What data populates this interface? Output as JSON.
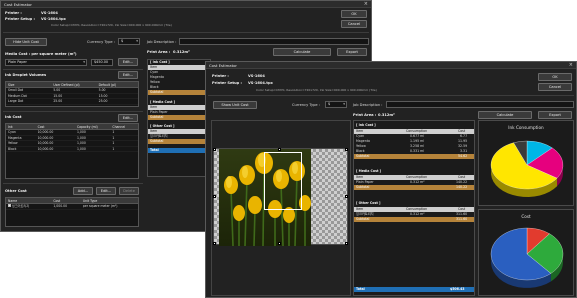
{
  "back": {
    "title": "Cost Estimator",
    "close_glyph": "×",
    "printer_label": "Printer :",
    "printer_value": "VS-1604",
    "setup_label": "Printer Setup :",
    "setup_value": "VS-1604.tpx",
    "setup_detail": "Color Setup=CMYK, Resolution=720x720, Ink Size=900.000 x 900.000mm (Tile)",
    "ok_label": "OK",
    "cancel_label": "Cancel",
    "hide_unit_cost": "Hide Unit Cost",
    "currency_label": "Currency Type :",
    "currency_value": "$",
    "job_desc_label": "Job Description :",
    "print_area_label": "Print Area :",
    "print_area_value": "0.312m²",
    "calculate": "Calculate",
    "export": "Export",
    "media_cost_label": "Media Cost : per square meter (m²)",
    "media_value": "Plain Paper",
    "media_price": "$450.00",
    "edit": "Edit...",
    "droplet_title": "Ink Droplet Volumes",
    "droplet_cols": [
      "Size",
      "User Defined (pl)",
      "Default (pl)"
    ],
    "droplet_rows": [
      [
        "Small Dot",
        "5.00",
        "5.00"
      ],
      [
        "Medium Dot",
        "15.00",
        "15.00"
      ],
      [
        "Large Dot",
        "25.00",
        "25.00"
      ]
    ],
    "ink_cost_title": "Ink Cost",
    "ink_cols": [
      "Ink",
      "Cost",
      "Capacity (ml)",
      "Channel"
    ],
    "ink_rows": [
      [
        "Cyan",
        "10,000.00",
        "1,000",
        "1"
      ],
      [
        "Magenta",
        "10,000.00",
        "1,000",
        "1"
      ],
      [
        "Yellow",
        "10,000.00",
        "1,000",
        "1"
      ],
      [
        "Black",
        "10,000.00",
        "1,000",
        "1"
      ]
    ],
    "other_cost_title": "Other Cost",
    "add": "Add...",
    "edit2": "Edit...",
    "delete": "Delete",
    "other_cols": [
      "Name",
      "Cost",
      "Unit Type"
    ],
    "other_rows": [
      [
        "잉크카트리지",
        "1,000.00",
        "per square meter (m²)"
      ]
    ],
    "summary": {
      "ink_cost": "[ Ink Cost ]",
      "ink_items": [
        "Item",
        "Cyan",
        "Magenta",
        "Yellow",
        "Black",
        "Subtotal"
      ],
      "media_cost": "[ Media Cost ]",
      "media_items": [
        "Item",
        "Plain Paper",
        "Subtotal"
      ],
      "other_cost": "[ Other Cost ]",
      "other_items": [
        "Item",
        "잉크카트리지",
        "Subtotal"
      ],
      "total": "Total"
    }
  },
  "front": {
    "title": "Cost Estimator",
    "close_glyph": "×",
    "printer_label": "Printer :",
    "printer_value": "VS-1604",
    "setup_label": "Printer Setup :",
    "setup_value": "VS-1604.tpx",
    "setup_detail": "Color Setup=CMYK, Resolution=720x720, Ink Size=900.000 x 900.000mm (Tile)",
    "ok_label": "OK",
    "cancel_label": "Cancel",
    "show_unit_cost": "Show Unit Cost",
    "currency_label": "Currency Type :",
    "currency_value": "$",
    "job_desc_label": "Job Description :",
    "print_area_label": "Print Area :",
    "print_area_value": "0.312m²",
    "calculate": "Calculate",
    "export": "Export",
    "ink_cost": {
      "title": "[ Ink Cost ]",
      "cols": [
        "Item",
        "Consumption",
        "Cost"
      ],
      "rows": [
        [
          "Cyan",
          "0.677 ml",
          "6.77"
        ],
        [
          "Magenta",
          "1.195 ml",
          "11.95"
        ],
        [
          "Yellow",
          "3.258 ml",
          "32.59"
        ],
        [
          "Black",
          "0.331 ml",
          "3.31"
        ]
      ],
      "subtotal": [
        "Subtotal",
        "",
        "54.62"
      ]
    },
    "media_cost": {
      "title": "[ Media Cost ]",
      "cols": [
        "Item",
        "Consumption",
        "Cost"
      ],
      "rows": [
        [
          "Plain Paper",
          "0.312 m²",
          "140.22"
        ]
      ],
      "subtotal": [
        "Subtotal",
        "",
        "140.22"
      ]
    },
    "other_cost": {
      "title": "[ Other Cost ]",
      "cols": [
        "Item",
        "Consumption",
        "Cost"
      ],
      "rows": [
        [
          "잉크카트리지",
          "0.312 m²",
          "311.60"
        ]
      ],
      "subtotal": [
        "Subtotal",
        "",
        "311.60"
      ]
    },
    "total": [
      "Total",
      "$506.43"
    ],
    "chart1_title": "Ink Consumption",
    "chart2_title": "Cost"
  },
  "chart_data": [
    {
      "type": "pie",
      "title": "Ink Consumption",
      "categories": [
        "Cyan",
        "Magenta",
        "Yellow",
        "Black"
      ],
      "values": [
        0.677,
        1.195,
        3.258,
        0.331
      ],
      "colors": [
        "#00b7e6",
        "#e6007e",
        "#ffe600",
        "#3a3a3a"
      ]
    },
    {
      "type": "pie",
      "title": "Cost",
      "categories": [
        "Ink",
        "Media",
        "Other"
      ],
      "values": [
        54.62,
        140.22,
        311.6
      ],
      "colors": [
        "#e23b2e",
        "#2eaa3c",
        "#2a5fc0"
      ]
    }
  ],
  "colors": {
    "window_bg": "#222222",
    "selection": "#1f5fa8",
    "subtotal": "#b5833a",
    "total": "#1f6fb5"
  }
}
